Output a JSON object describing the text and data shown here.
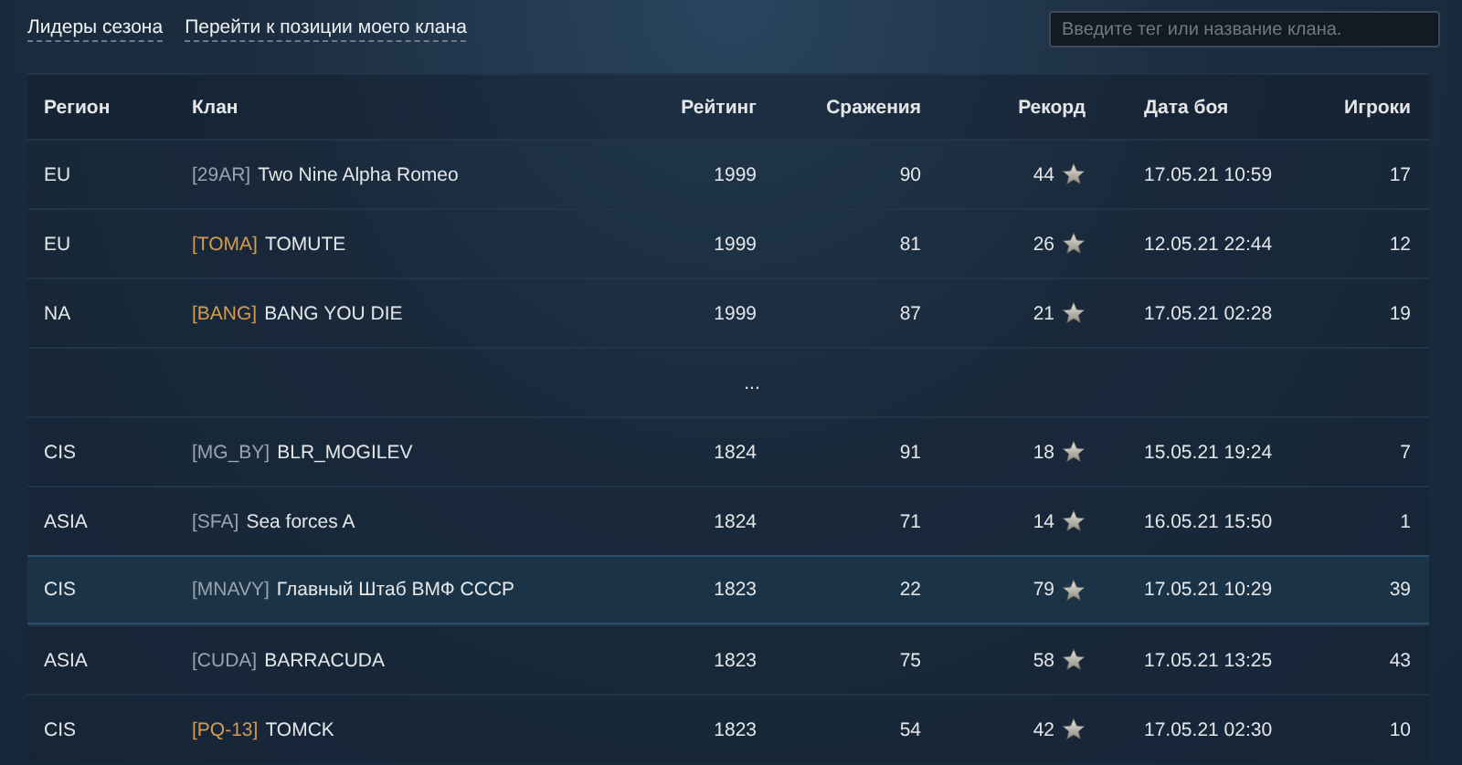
{
  "nav_links": [
    {
      "label": "Лидеры сезона"
    },
    {
      "label": "Перейти к позиции моего клана"
    }
  ],
  "search": {
    "placeholder": "Введите тег или название клана."
  },
  "table": {
    "columns": [
      "Регион",
      "Клан",
      "Рейтинг",
      "Сражения",
      "Рекорд",
      "Дата боя",
      "Игроки"
    ],
    "rows": [
      {
        "kind": "clan",
        "selected": false,
        "region": "EU",
        "tag": "[29AR]",
        "tag_highlighted": false,
        "name": "Two Nine Alpha Romeo",
        "rating": "1999",
        "battles": "90",
        "record": "44",
        "date": "17.05.21 10:59",
        "players": "17"
      },
      {
        "kind": "clan",
        "selected": false,
        "region": "EU",
        "tag": "[TOMA]",
        "tag_highlighted": true,
        "name": "TOMUTE",
        "rating": "1999",
        "battles": "81",
        "record": "26",
        "date": "12.05.21 22:44",
        "players": "12"
      },
      {
        "kind": "clan",
        "selected": false,
        "region": "NA",
        "tag": "[BANG]",
        "tag_highlighted": true,
        "name": "BANG YOU DIE",
        "rating": "1999",
        "battles": "87",
        "record": "21",
        "date": "17.05.21 02:28",
        "players": "19"
      },
      {
        "kind": "gap",
        "text": "..."
      },
      {
        "kind": "clan",
        "selected": false,
        "region": "CIS",
        "tag": "[MG_BY]",
        "tag_highlighted": false,
        "name": "BLR_MOGILEV",
        "rating": "1824",
        "battles": "91",
        "record": "18",
        "date": "15.05.21 19:24",
        "players": "7"
      },
      {
        "kind": "clan",
        "selected": false,
        "region": "ASIA",
        "tag": "[SFA]",
        "tag_highlighted": false,
        "name": "Sea forces A",
        "rating": "1824",
        "battles": "71",
        "record": "14",
        "date": "16.05.21 15:50",
        "players": "1"
      },
      {
        "kind": "clan",
        "selected": true,
        "region": "CIS",
        "tag": "[MNAVY]",
        "tag_highlighted": false,
        "name": "Главный Штаб ВМФ СССР",
        "rating": "1823",
        "battles": "22",
        "record": "79",
        "date": "17.05.21 10:29",
        "players": "39"
      },
      {
        "kind": "clan",
        "selected": false,
        "region": "ASIA",
        "tag": "[CUDA]",
        "tag_highlighted": false,
        "name": "BARRACUDA",
        "rating": "1823",
        "battles": "75",
        "record": "58",
        "date": "17.05.21 13:25",
        "players": "43"
      },
      {
        "kind": "clan",
        "selected": false,
        "region": "CIS",
        "tag": "[PQ-13]",
        "tag_highlighted": true,
        "name": "TOMCK",
        "rating": "1823",
        "battles": "54",
        "record": "42",
        "date": "17.05.21 02:30",
        "players": "10"
      }
    ]
  }
}
